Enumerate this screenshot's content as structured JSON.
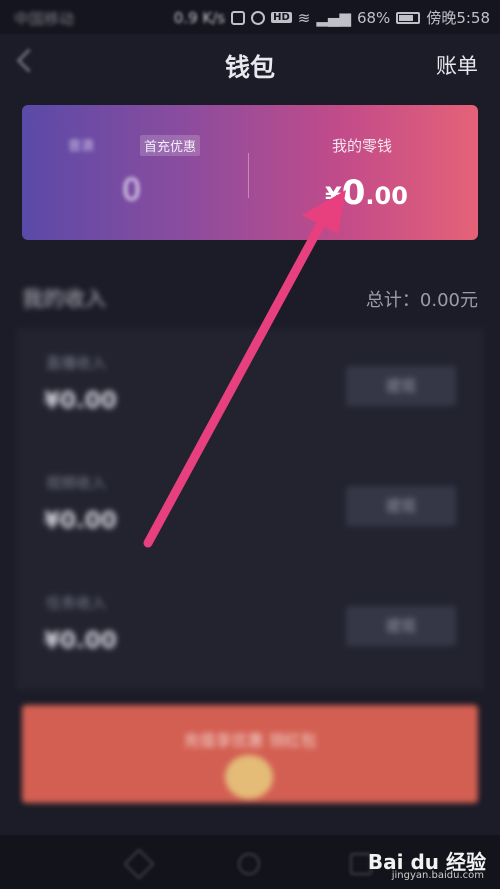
{
  "status_bar": {
    "carrier": "中国移动",
    "speed": "0.9 K/s",
    "hd": "HD",
    "battery": "68%",
    "time": "傍晚5:58"
  },
  "header": {
    "title": "钱包",
    "bill_label": "账单"
  },
  "balance": {
    "coins_label": "音浪",
    "promo_badge": "首充优惠",
    "coins_value": "0",
    "change_label": "我的零钱",
    "currency": "¥",
    "change_int": "0",
    "change_dec": ".00"
  },
  "income": {
    "heading": "我的收入",
    "total": "总计：0.00元",
    "rows": [
      {
        "label": "直播收入",
        "amount": "¥0.00",
        "action": "提现"
      },
      {
        "label": "视频收入",
        "amount": "¥0.00",
        "action": "提现"
      },
      {
        "label": "任务收入",
        "amount": "¥0.00",
        "action": "提现"
      }
    ]
  },
  "promo": {
    "text": "充值享优惠 领红包"
  },
  "watermark": {
    "brand": "Bai du 经验",
    "url": "jingyan.baidu.com"
  },
  "colors": {
    "background": "#1b1c27",
    "card_gradient_start": "#5a4aa8",
    "card_gradient_end": "#e56278",
    "arrow": "#e8407f"
  }
}
